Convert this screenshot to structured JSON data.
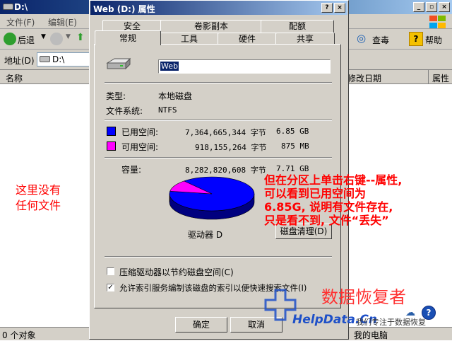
{
  "explorer": {
    "title": "D:\\",
    "menu": [
      "文件(F)",
      "编辑(E)"
    ],
    "toolbar": {
      "back_label": "后退",
      "search_label": "查毒",
      "help_label": "帮助"
    },
    "address": {
      "label": "地址(D)",
      "value": "D:\\"
    },
    "columns": {
      "name": "名称",
      "modified": "修改日期",
      "attributes": "属性"
    },
    "status": {
      "objects": "0 个对象",
      "computer": "我的电脑"
    }
  },
  "annotations": {
    "left_note": [
      "这里没有",
      "任何文件"
    ],
    "right_note": [
      "但在分区上单击右键--属性,",
      "可以看到已用空间为",
      "6.85G, 说明有文件存在,",
      "只是看不到, 文件“丢失”"
    ]
  },
  "dialog": {
    "title": "Web (D:) 属性",
    "tabs_back": [
      "安全",
      "卷影副本",
      "配额"
    ],
    "tabs_front": [
      "常规",
      "工具",
      "硬件",
      "共享"
    ],
    "volume_name": "Web",
    "type_label": "类型:",
    "type_value": "本地磁盘",
    "fs_label": "文件系统:",
    "fs_value": "NTFS",
    "used_label": "已用空间:",
    "used_bytes": "7,364,665,344 字节",
    "used_size": "6.85 GB",
    "free_label": "可用空间:",
    "free_bytes": "918,155,264 字节",
    "free_size": "875 MB",
    "capacity_label": "容量:",
    "capacity_bytes": "8,282,820,608 字节",
    "capacity_size": "7.71 GB",
    "drive_label": "驱动器 D",
    "cleanup_button": "磁盘清理(D)",
    "compress_option": "压缩驱动器以节约磁盘空间(C)",
    "index_option": "允许索引服务编制该磁盘的索引以便快速搜索文件(I)",
    "ok_button": "确定",
    "cancel_button": "取消"
  },
  "watermark": {
    "cn": "数据恢复者",
    "en": "HelpData.Cn",
    "slogan": "我们专注于数据恢复"
  },
  "pie": {
    "used_fraction": 0.889,
    "used_color": "#0000ff",
    "free_color": "#ff00ff"
  }
}
